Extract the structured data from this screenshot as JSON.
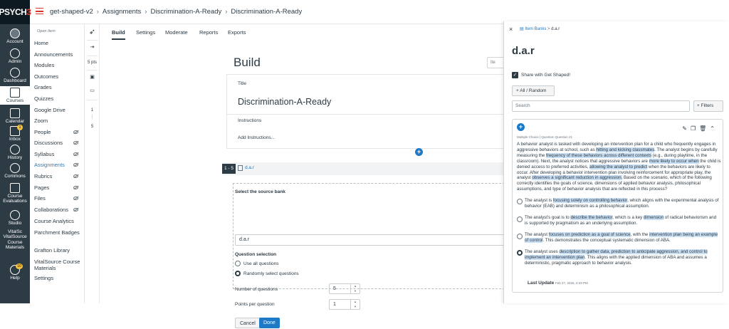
{
  "global_nav": {
    "logo_prefix": "PSYCH",
    "logo_suffix": "3",
    "items": [
      {
        "label": "Account"
      },
      {
        "label": "Admin"
      },
      {
        "label": "Dashboard"
      },
      {
        "label": "Courses"
      },
      {
        "label": "Calendar"
      },
      {
        "label": "Inbox",
        "badge": "1"
      },
      {
        "label": "History"
      },
      {
        "label": "Commons"
      },
      {
        "label": "Course Evaluations"
      },
      {
        "label": "Studio"
      },
      {
        "label_top": "VitalSc",
        "label": "VitalSource Course Materials"
      },
      {
        "label": "Help",
        "badge": "10"
      }
    ]
  },
  "breadcrumb": [
    "get-shaped-v2",
    "Assignments",
    "Discrimination-A-Ready",
    "Discrimination-A-Ready"
  ],
  "course_nav": {
    "open_item": "Open Item",
    "items": [
      "Home",
      "Announcements",
      "Modules",
      "Outcomes",
      "Grades",
      "Quizzes",
      "Google Drive",
      "Zoom",
      "People",
      "Discussions",
      "Syllabus",
      "Assignments",
      "Rubrics",
      "Pages",
      "Files",
      "Collaborations",
      "Course Analytics",
      "Parchment Badges",
      "Grafton Library",
      "VitalSource Course Materials",
      "Settings"
    ]
  },
  "tool_rail": {
    "points": "5 pts",
    "pager_top": "1",
    "pager_bottom": "5"
  },
  "tabs": [
    "Build",
    "Settings",
    "Moderate",
    "Reports",
    "Exports"
  ],
  "build": {
    "heading": "Build",
    "item_banks_btn": "Ite",
    "title_label": "Title",
    "title_value": "Discrimination-A-Ready",
    "instructions_label": "Instructions",
    "instructions_placeholder": "Add Instructions...",
    "bank_range": "1 - 5",
    "bank_name": "d.a.r"
  },
  "source_panel": {
    "select_label": "Select the source bank",
    "select_value": "d.a.r",
    "question_selection_label": "Question selection",
    "option_all": "Use all questions",
    "option_random": "Randomly select questions",
    "num_questions_label": "Number of questions",
    "num_questions_value": "5",
    "points_label": "Points per question",
    "points_value": "1",
    "cancel": "Cancel",
    "done": "Done"
  },
  "tray": {
    "close": "×",
    "crumb_root": "Item Banks",
    "crumb_sep": ">",
    "crumb_current": "d.a.r",
    "title": "d.a.r",
    "share_label": "Share with Get Shaped!",
    "all_random": "All / Random",
    "search_placeholder": "Search",
    "filters": "Filters",
    "question": {
      "meta": "Multiple Choice | Question Question 21",
      "stem_parts": [
        {
          "t": "A behavior analyst is tasked with developing an intervention plan for a child who frequently engages in aggressive behaviors at school, such as ",
          "h": false
        },
        {
          "t": "hitting and kicking classmates",
          "h": true
        },
        {
          "t": ". The analyst begins by carefully measuring the ",
          "h": false
        },
        {
          "t": "frequency of these behaviors across different contexts",
          "h": true
        },
        {
          "t": " (e.g., during playtime, in the classroom). Next, the analyst notices that aggressive behaviors are ",
          "h": false
        },
        {
          "t": "more likely to occur when",
          "h": true
        },
        {
          "t": " the child is denied access to preferred activities, ",
          "h": false
        },
        {
          "t": "allowing the analyst to predict",
          "h": true
        },
        {
          "t": " when the behaviors are likely to occur. After developing a behavior intervention plan involving reinforcement for appropriate play, the analyst ",
          "h": false
        },
        {
          "t": "observes a significant reduction in aggression.",
          "h": true
        },
        {
          "t": " Based on the scenario, which of the following correctly identifies the goals of science, dimensions of applied behavior analysis, philosophical assumptions, and type of behavior analysis that are reflected in this process?",
          "h": false
        }
      ],
      "answers": [
        {
          "parts": [
            {
              "t": "The analyst is ",
              "h": false
            },
            {
              "t": "focusing solely on controlling behavior",
              "h": true
            },
            {
              "t": ", which aligns with the experimental analysis of behavior (EAB) and determinism as a philosophical assumption.",
              "h": false
            }
          ],
          "selected": false
        },
        {
          "parts": [
            {
              "t": "The analyst's goal is to ",
              "h": false
            },
            {
              "t": "describe the behavior",
              "h": true
            },
            {
              "t": ", which is a key ",
              "h": false
            },
            {
              "t": "dimension",
              "h": true
            },
            {
              "t": " of radical behaviorism and is supported by pragmatism as an underlying assumption.",
              "h": false
            }
          ],
          "selected": false
        },
        {
          "parts": [
            {
              "t": "The analyst ",
              "h": false
            },
            {
              "t": "focuses on prediction as a goal of science",
              "h": true
            },
            {
              "t": ", with the ",
              "h": false
            },
            {
              "t": "intervention plan being an example of control",
              "h": true
            },
            {
              "t": ". This demonstrates the conceptual systematic dimension of ABA.",
              "h": false
            }
          ],
          "selected": false
        },
        {
          "parts": [
            {
              "t": "The analyst uses ",
              "h": false
            },
            {
              "t": "description to gather data, prediction to anticipate aggression, and control to implement an intervention plan",
              "h": true
            },
            {
              "t": ". This aligns with the applied dimension of ABA and assumes a deterministic, pragmatic approach to behavior analysis.",
              "h": false
            }
          ],
          "selected": true
        }
      ],
      "last_update_label": "Last Update",
      "last_update_value": "Feb 27, 2025, 2:33 PM"
    }
  },
  "colors": {
    "accent": "#1e7ac6",
    "nav_bg": "#2d3b45",
    "hamburger": "#d5342f",
    "highlight": "#c9dff3"
  }
}
